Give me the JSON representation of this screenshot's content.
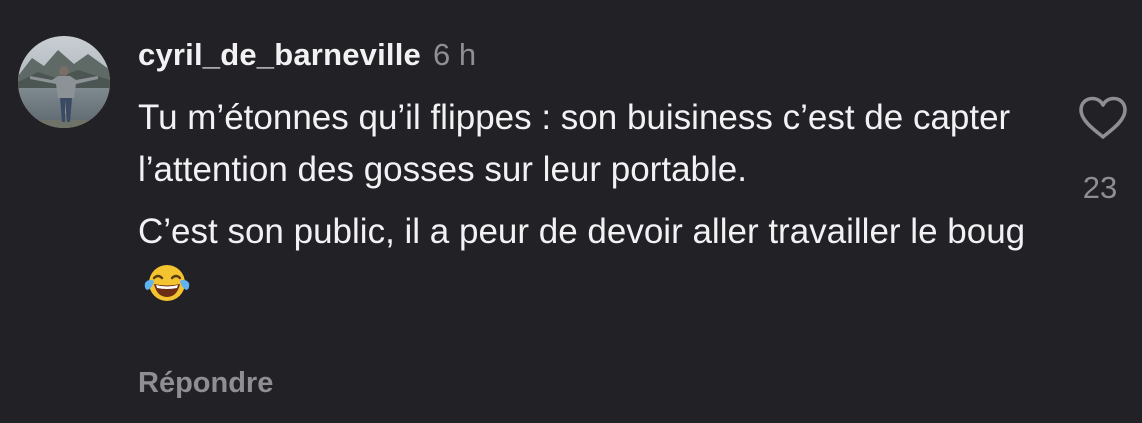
{
  "comment": {
    "username": "cyril_de_barneville",
    "time": "6 h",
    "paragraphs": [
      "Tu m’étonnes qu’il flippes : son buisiness c’est de capter l’attention des gosses sur leur portable.",
      "C’est son public, il a peur de devoir aller travailler le boug"
    ],
    "emoji_icon": "face-with-tears-of-joy-icon",
    "reply_label": "Répondre",
    "likes": "23",
    "like_icon": "heart-outline-icon",
    "avatar_icon": "user-avatar-photo"
  },
  "colors": {
    "background": "#222226",
    "text": "#f2f2f4",
    "secondary": "#8e8e93"
  }
}
